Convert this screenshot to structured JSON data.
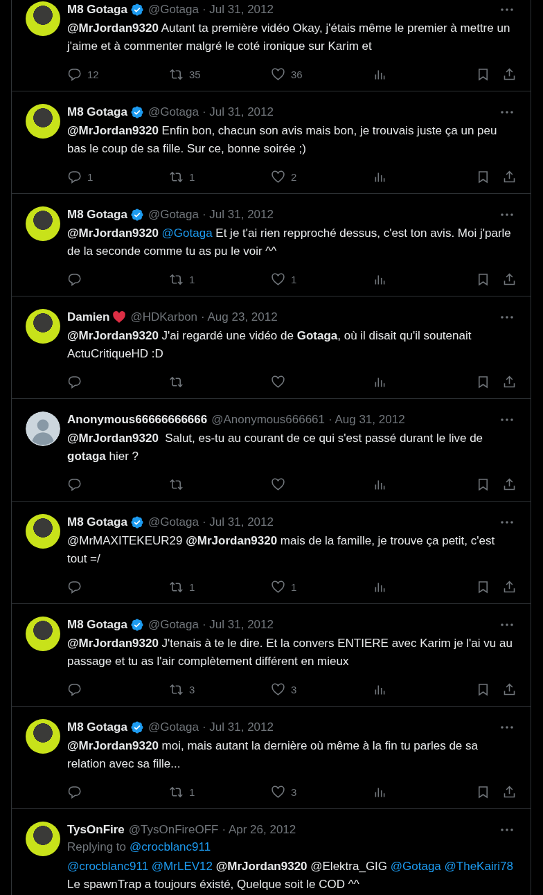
{
  "tweets": [
    {
      "verified": true,
      "name": "M8 Gotaga",
      "handle": "@Gotaga",
      "date": "· Jul 31, 2012",
      "body": [
        {
          "kind": "bold",
          "text": "@MrJordan9320"
        },
        {
          "kind": "text",
          "text": " Autant ta première vidéo Okay, j'étais même le premier à mettre un j'aime et à commenter malgré le coté ironique sur Karim et"
        }
      ],
      "replies": "12",
      "retweets": "35",
      "likes": "36"
    },
    {
      "verified": true,
      "name": "M8 Gotaga",
      "handle": "@Gotaga",
      "date": "· Jul 31, 2012",
      "body": [
        {
          "kind": "bold",
          "text": "@MrJordan9320"
        },
        {
          "kind": "text",
          "text": " Enfin bon, chacun son avis mais bon, je trouvais juste ça un peu bas le coup de sa fille. Sur ce, bonne soirée ;)"
        }
      ],
      "replies": "1",
      "retweets": "1",
      "likes": "2"
    },
    {
      "verified": true,
      "name": "M8 Gotaga",
      "handle": "@Gotaga",
      "date": "· Jul 31, 2012",
      "body": [
        {
          "kind": "bold",
          "text": "@MrJordan9320 "
        },
        {
          "kind": "link",
          "text": "@Gotaga"
        },
        {
          "kind": "text",
          "text": " Et je t'ai rien repproché dessus, c'est ton avis. Moi j'parle de la seconde comme tu as pu le voir ^^"
        }
      ],
      "retweets": "1",
      "likes": "1"
    },
    {
      "heart": true,
      "name": "Damien",
      "handle": "@HDKarbon",
      "date": "· Aug 23, 2012",
      "body": [
        {
          "kind": "bold",
          "text": "@MrJordan9320"
        },
        {
          "kind": "text",
          "text": " J'ai regardé une vidéo de "
        },
        {
          "kind": "bold",
          "text": "Gotaga"
        },
        {
          "kind": "text",
          "text": ", où il disait qu'il soutenait ActuCritiqueHD :D"
        }
      ]
    },
    {
      "default_avatar": true,
      "name": "Anonymous66666666666",
      "handle": "@Anonymous666661",
      "date": "· Aug 31, 2012",
      "body": [
        {
          "kind": "bold",
          "text": "@MrJordan9320"
        },
        {
          "kind": "text",
          "text": "  Salut, es-tu au courant de ce qui s'est passé durant le live de "
        },
        {
          "kind": "bold",
          "text": "gotaga"
        },
        {
          "kind": "text",
          "text": " hier ?"
        }
      ]
    },
    {
      "verified": true,
      "name": "M8 Gotaga",
      "handle": "@Gotaga",
      "date": "· Jul 31, 2012",
      "body": [
        {
          "kind": "text",
          "text": "@MrMAXITEKEUR29 "
        },
        {
          "kind": "bold",
          "text": "@MrJordan9320"
        },
        {
          "kind": "text",
          "text": " mais de la famille, je trouve ça petit, c'est tout =/"
        }
      ],
      "retweets": "1",
      "likes": "1"
    },
    {
      "verified": true,
      "name": "M8 Gotaga",
      "handle": "@Gotaga",
      "date": "· Jul 31, 2012",
      "body": [
        {
          "kind": "bold",
          "text": "@MrJordan9320"
        },
        {
          "kind": "text",
          "text": " J'tenais à te le dire. Et la convers ENTIERE avec Karim je l'ai vu au passage et tu as l'air complètement différent en mieux"
        }
      ],
      "retweets": "3",
      "likes": "3"
    },
    {
      "verified": true,
      "name": "M8 Gotaga",
      "handle": "@Gotaga",
      "date": "· Jul 31, 2012",
      "body": [
        {
          "kind": "bold",
          "text": "@MrJordan9320"
        },
        {
          "kind": "text",
          "text": " moi, mais autant la dernière où même à la fin tu parles de sa relation avec sa fille..."
        }
      ],
      "retweets": "1",
      "likes": "3"
    },
    {
      "name": "TysOnFire",
      "handle": "@TysOnFireOFF",
      "date": "· Apr 26, 2012",
      "replying_label": "Replying to",
      "replying_to": "@crocblanc911",
      "body": [
        {
          "kind": "link",
          "text": "@crocblanc911 "
        },
        {
          "kind": "link",
          "text": "@MrLEV12"
        },
        {
          "kind": "bold",
          "text": " @MrJordan9320"
        },
        {
          "kind": "text",
          "text": " @Elektra_GIG "
        },
        {
          "kind": "link",
          "text": "@Gotaga "
        },
        {
          "kind": "link",
          "text": "@TheKairi78"
        },
        {
          "kind": "text",
          "text": " Le spawnTrap a toujours éxisté, Quelque soit le COD ^^"
        }
      ]
    }
  ]
}
